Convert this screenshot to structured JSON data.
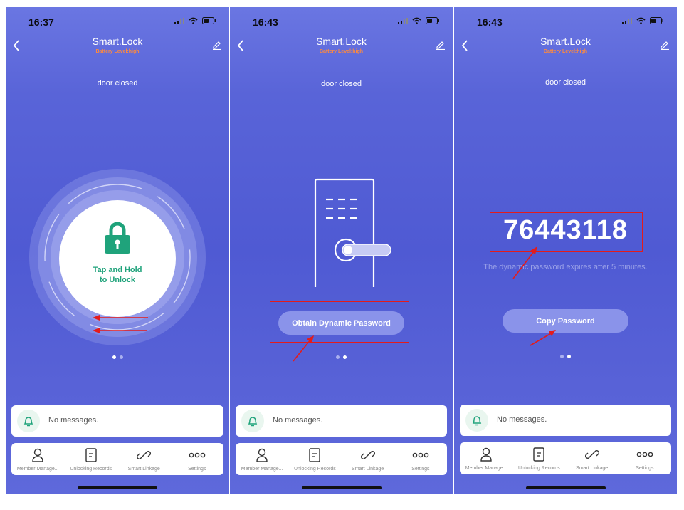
{
  "status": {
    "times": [
      "16:37",
      "16:43",
      "16:43"
    ]
  },
  "header": {
    "title": "Smart.Lock",
    "battery": "Battery Level:high",
    "back_icon": "chevron-left-icon",
    "edit_icon": "pencil-icon"
  },
  "door_status": "door closed",
  "screen1": {
    "unlock_label_1": "Tap and Hold",
    "unlock_label_2": "to Unlock",
    "accent": "#1fa37b"
  },
  "screen2": {
    "obtain_button": "Obtain Dynamic Password"
  },
  "screen3": {
    "password": "76443118",
    "expires_text": "The dynamic password expires after 5 minutes.",
    "copy_button": "Copy Password"
  },
  "pager": {
    "pages": 2
  },
  "messages": {
    "text": "No messages.",
    "icon": "bell-icon"
  },
  "tabs": [
    {
      "label": "Member Manage...",
      "icon": "person-icon"
    },
    {
      "label": "Unlocking Records",
      "icon": "document-icon"
    },
    {
      "label": "Smart Linkage",
      "icon": "link-icon"
    },
    {
      "label": "Settings",
      "icon": "more-icon"
    }
  ],
  "colors": {
    "background": "#5560d6",
    "battery": "#ff8a3d",
    "annotation": "#e41b1b"
  }
}
